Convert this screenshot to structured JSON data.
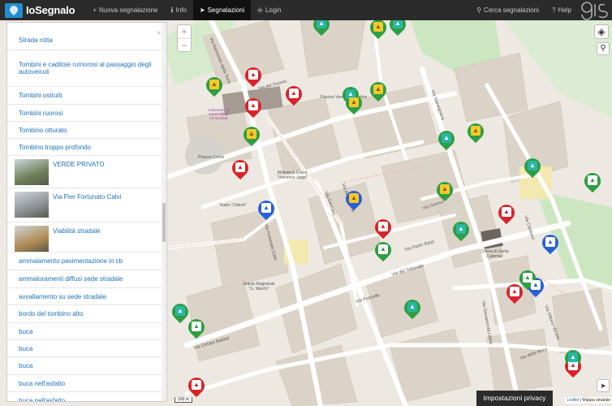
{
  "nav": {
    "brand": "IoSegnalo",
    "items": [
      {
        "icon": "+",
        "label": "Nuova segnalazione"
      },
      {
        "icon": "ℹ",
        "label": "Info"
      },
      {
        "icon": "➤",
        "label": "Segnalazioni"
      },
      {
        "icon": "⎆",
        "label": "Login"
      }
    ],
    "right_items": [
      {
        "icon": "⚲",
        "label": "Cerca segnalazioni"
      },
      {
        "icon": "?",
        "label": "Help"
      }
    ],
    "partner_logo_text": "gis3"
  },
  "panel": {
    "close_glyph": "×",
    "rows": [
      {
        "label": "Strada rotta"
      },
      {
        "label": "Tombini e caditoie rumorosi al passaggio degli autoveicoli"
      },
      {
        "label": "Tombini ostruiti"
      },
      {
        "label": "Tombini ruorosi"
      },
      {
        "label": "Tombino otturato"
      },
      {
        "label": "Tombino troppo profondo"
      },
      {
        "label": "VERDE PRIVATO",
        "thumb": true,
        "thumb_color": "#6d7f5a"
      },
      {
        "label": "Via Pier Fortunato Calvi",
        "thumb": true,
        "thumb_color": "#8b8f94"
      },
      {
        "label": "Viabilità stradale",
        "thumb": true,
        "thumb_color": "#b08a52"
      },
      {
        "label": "ammalamento pavimentazione in cb"
      },
      {
        "label": "ammaloramenti diffusi sede stradale"
      },
      {
        "label": "avvallamento su sede stradale"
      },
      {
        "label": "bordo del tombino alto"
      },
      {
        "label": "buca"
      },
      {
        "label": "buca"
      },
      {
        "label": "buca"
      },
      {
        "label": "buca nell'asfalto"
      },
      {
        "label": "buca nell'asfalto"
      }
    ]
  },
  "map": {
    "zoom_in": "+",
    "zoom_out": "−",
    "layers_glyph": "◈",
    "search_glyph": "⚲",
    "locate_glyph": "➤",
    "privacy_button": "Impostazioni privacy",
    "attribution_link": "Leaflet",
    "attribution_text": "| Mappa stradale",
    "scale_label": "100 m",
    "streets": [
      {
        "name": "Via Raimondo della Torre"
      },
      {
        "name": "Via del Duomo"
      },
      {
        "name": "Piazza Venti Settembre"
      },
      {
        "name": "Piazza Cents"
      },
      {
        "name": "Via Fortunato Calvi"
      },
      {
        "name": "Via Cesare Battisti"
      },
      {
        "name": "Via del Tribunale"
      },
      {
        "name": "Via Poscolle"
      },
      {
        "name": "Via dei Calzolai"
      },
      {
        "name": "Via Cavour"
      },
      {
        "name": "Via Savorgnana"
      },
      {
        "name": "Via Carducci"
      },
      {
        "name": "Via Giovanni da Udine"
      },
      {
        "name": "Via Paolo Sarpi"
      },
      {
        "name": "Via Canciani"
      },
      {
        "name": "Via Vittorio Veneto"
      },
      {
        "name": "Via delle Mura"
      },
      {
        "name": "Biblioteca Civica \"Vincenzo Joppi\""
      },
      {
        "name": "Teatro \"Odeon\""
      },
      {
        "name": "Istituto Magistrale \"G. Marchi\""
      },
      {
        "name": "Chiesa di Santa Caterina"
      },
      {
        "name": "Cattedrale di Santa Maria Annunziata"
      }
    ],
    "markers": [
      {
        "color": "green",
        "variant": "teal-in",
        "glyph": "▲"
      },
      {
        "color": "green",
        "variant": "yellow-in",
        "glyph": "▲"
      },
      {
        "color": "green",
        "variant": "teal-in",
        "glyph": "▲"
      },
      {
        "color": "red",
        "variant": "",
        "glyph": "▲"
      },
      {
        "color": "green",
        "variant": "yellow-in",
        "glyph": "▲"
      },
      {
        "color": "red",
        "variant": "",
        "glyph": "▲"
      },
      {
        "color": "red",
        "variant": "",
        "glyph": "▲"
      },
      {
        "color": "green",
        "variant": "teal-in",
        "glyph": "▲"
      },
      {
        "color": "green",
        "variant": "yellow-in",
        "glyph": "▲"
      },
      {
        "color": "green",
        "variant": "yellow-in",
        "glyph": "▲"
      },
      {
        "color": "green",
        "variant": "yellow-in",
        "glyph": "▲"
      },
      {
        "color": "green",
        "variant": "teal-in",
        "glyph": "▲"
      },
      {
        "color": "green",
        "variant": "yellow-in",
        "glyph": "▲"
      },
      {
        "color": "red",
        "variant": "",
        "glyph": "▲"
      },
      {
        "color": "blue",
        "variant": "yellow-in",
        "glyph": "▲"
      },
      {
        "color": "blue",
        "variant": "",
        "glyph": "▲"
      },
      {
        "color": "green",
        "variant": "teal-in",
        "glyph": "▲"
      },
      {
        "color": "green",
        "variant": "yellow-in",
        "glyph": "▲"
      },
      {
        "color": "red",
        "variant": "",
        "glyph": "▲"
      },
      {
        "color": "green",
        "variant": "",
        "glyph": "▲"
      },
      {
        "color": "green",
        "variant": "teal-in",
        "glyph": "▲"
      },
      {
        "color": "red",
        "variant": "",
        "glyph": "▲"
      },
      {
        "color": "green",
        "variant": "teal-in",
        "glyph": "▲"
      },
      {
        "color": "green",
        "variant": "",
        "glyph": "▲"
      },
      {
        "color": "blue",
        "variant": "",
        "glyph": "▲"
      },
      {
        "color": "red",
        "variant": "",
        "glyph": "▲"
      },
      {
        "color": "blue",
        "variant": "",
        "glyph": "▲"
      },
      {
        "color": "green",
        "variant": "teal-in",
        "glyph": "▲"
      },
      {
        "color": "green",
        "variant": "teal-in",
        "glyph": "▲"
      },
      {
        "color": "green",
        "variant": "",
        "glyph": "▲"
      },
      {
        "color": "red",
        "variant": "",
        "glyph": "▲"
      },
      {
        "color": "green",
        "variant": "",
        "glyph": "▲"
      },
      {
        "color": "red",
        "variant": "",
        "glyph": "▲"
      },
      {
        "color": "green",
        "variant": "teal-in",
        "glyph": "▲"
      },
      {
        "color": "green",
        "variant": "",
        "glyph": "▲"
      }
    ]
  }
}
